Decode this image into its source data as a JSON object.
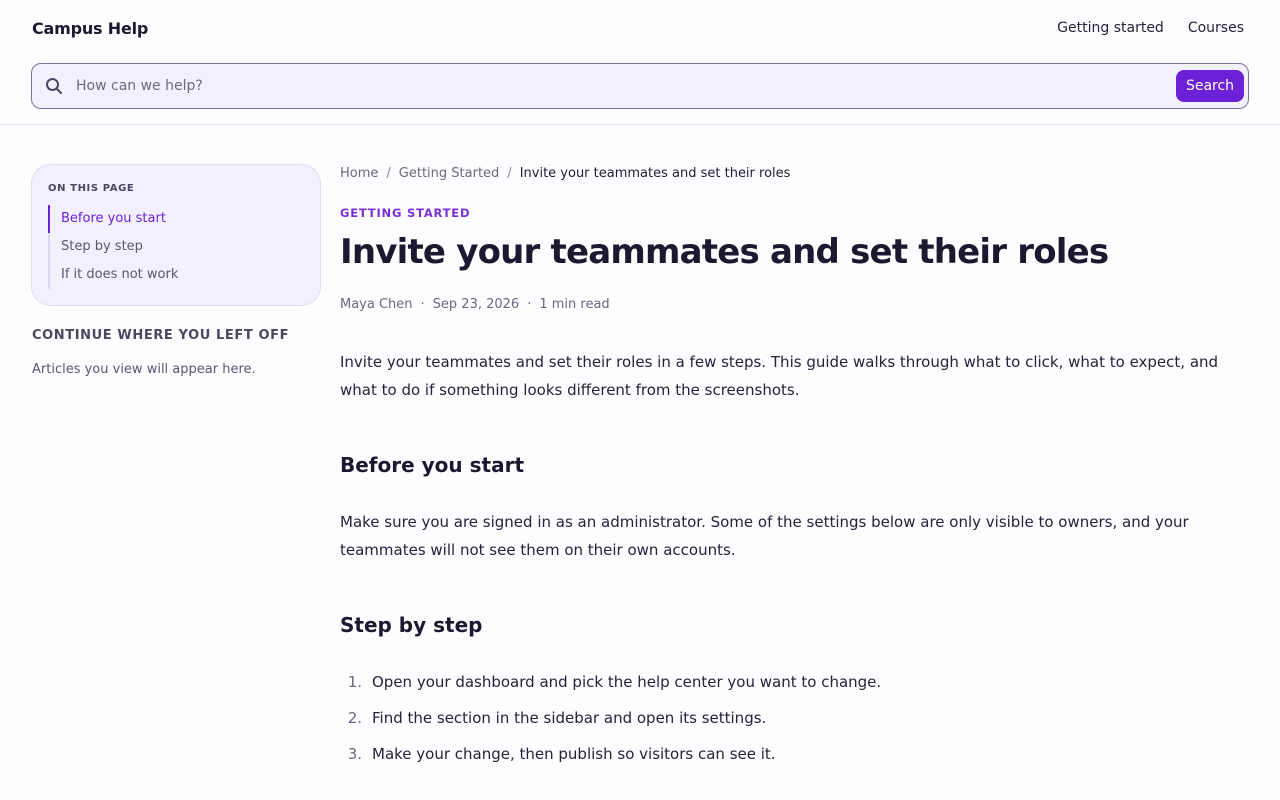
{
  "header": {
    "logo": "Campus Help",
    "nav": [
      "Getting started",
      "Courses"
    ],
    "search": {
      "placeholder": "How can we help?",
      "button": "Search"
    }
  },
  "toc": {
    "title": "ON THIS PAGE",
    "items": [
      {
        "label": "Before you start",
        "active": true
      },
      {
        "label": "Step by step",
        "active": false
      },
      {
        "label": "If it does not work",
        "active": false
      }
    ]
  },
  "recent": {
    "title": "CONTINUE WHERE YOU LEFT OFF",
    "empty": "Articles you view will appear here."
  },
  "breadcrumb": [
    "Home",
    "Getting Started",
    "Invite your teammates and set their roles"
  ],
  "article": {
    "category": "GETTING STARTED",
    "title": "Invite your teammates and set their roles",
    "author": "Maya Chen",
    "date": "Sep 23, 2026",
    "read_time": "1 min read",
    "intro": "Invite your teammates and set their roles in a few steps. This guide walks through what to click, what to expect, and what to do if something looks different from the screenshots.",
    "sections": [
      {
        "heading": "Before you start",
        "body": "Make sure you are signed in as an administrator. Some of the settings below are only visible to owners, and your teammates will not see them on their own accounts."
      },
      {
        "heading": "Step by step",
        "steps": [
          "Open your dashboard and pick the help center you want to change.",
          "Find the section in the sidebar and open its settings.",
          "Make your change, then publish so visitors can see it."
        ]
      }
    ]
  },
  "colors": {
    "accent": "#6b21d6",
    "search_bg": "#f3f0fd",
    "text": "#1f1d33"
  }
}
